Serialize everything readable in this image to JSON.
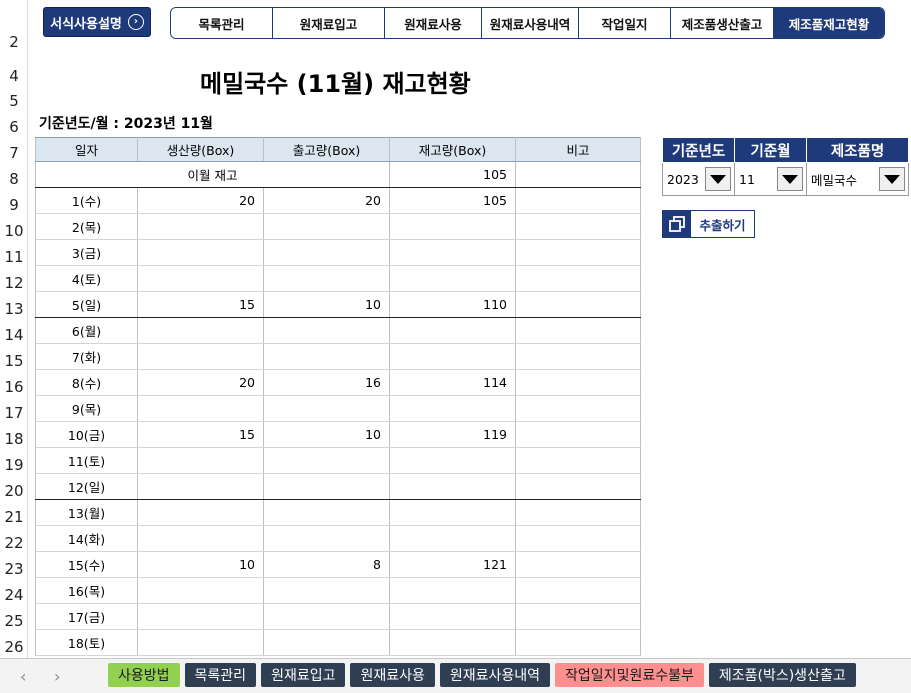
{
  "header": {
    "manual_button": "서식사용설명",
    "nav_tabs": [
      "목록관리",
      "원재료입고",
      "원재료사용",
      "원재료사용내역",
      "작업일지",
      "제조품생산출고",
      "제조품재고현황"
    ],
    "active_tab": "제조품재고현황"
  },
  "title": "메밀국수 (11월) 재고현황",
  "subtitle": "기준년도/월 : 2023년 11월",
  "table": {
    "columns": [
      "일자",
      "생산량(Box)",
      "출고량(Box)",
      "재고량(Box)",
      "비고"
    ],
    "carry_label": "이월 재고",
    "carry_value": "105",
    "rows": [
      {
        "date": "1(수)",
        "prod": "20",
        "out": "20",
        "stock": "105",
        "note": ""
      },
      {
        "date": "2(목)",
        "prod": "",
        "out": "",
        "stock": "",
        "note": ""
      },
      {
        "date": "3(금)",
        "prod": "",
        "out": "",
        "stock": "",
        "note": ""
      },
      {
        "date": "4(토)",
        "prod": "",
        "out": "",
        "stock": "",
        "note": ""
      },
      {
        "date": "5(일)",
        "prod": "15",
        "out": "10",
        "stock": "110",
        "note": ""
      },
      {
        "date": "6(월)",
        "prod": "",
        "out": "",
        "stock": "",
        "note": ""
      },
      {
        "date": "7(화)",
        "prod": "",
        "out": "",
        "stock": "",
        "note": ""
      },
      {
        "date": "8(수)",
        "prod": "20",
        "out": "16",
        "stock": "114",
        "note": ""
      },
      {
        "date": "9(목)",
        "prod": "",
        "out": "",
        "stock": "",
        "note": ""
      },
      {
        "date": "10(금)",
        "prod": "15",
        "out": "10",
        "stock": "119",
        "note": ""
      },
      {
        "date": "11(토)",
        "prod": "",
        "out": "",
        "stock": "",
        "note": ""
      },
      {
        "date": "12(일)",
        "prod": "",
        "out": "",
        "stock": "",
        "note": ""
      },
      {
        "date": "13(월)",
        "prod": "",
        "out": "",
        "stock": "",
        "note": ""
      },
      {
        "date": "14(화)",
        "prod": "",
        "out": "",
        "stock": "",
        "note": ""
      },
      {
        "date": "15(수)",
        "prod": "10",
        "out": "8",
        "stock": "121",
        "note": ""
      },
      {
        "date": "16(목)",
        "prod": "",
        "out": "",
        "stock": "",
        "note": ""
      },
      {
        "date": "17(금)",
        "prod": "",
        "out": "",
        "stock": "",
        "note": ""
      },
      {
        "date": "18(토)",
        "prod": "",
        "out": "",
        "stock": "",
        "note": ""
      }
    ]
  },
  "filter": {
    "headers": [
      "기준년도",
      "기준월",
      "제조품명"
    ],
    "year": "2023",
    "month": "11",
    "product": "메밀국수",
    "extract_button": "추출하기"
  },
  "row_numbers": [
    "2",
    "4",
    "5",
    "6",
    "7",
    "8",
    "9",
    "10",
    "11",
    "12",
    "13",
    "14",
    "15",
    "16",
    "17",
    "18",
    "19",
    "20",
    "21",
    "22",
    "23",
    "24",
    "25",
    "26"
  ],
  "sheet_tabs": [
    {
      "label": "사용방법",
      "style": "green"
    },
    {
      "label": "목록관리",
      "style": "dark"
    },
    {
      "label": "원재료입고",
      "style": "dark"
    },
    {
      "label": "원재료사용",
      "style": "dark"
    },
    {
      "label": "원재료사용내역",
      "style": "dark"
    },
    {
      "label": "작업일지및원료수불부",
      "style": "pink"
    },
    {
      "label": "제조품(박스)생산출고",
      "style": "dark"
    }
  ],
  "sheet_nav": {
    "prev": "‹",
    "next": "›"
  },
  "colors": {
    "navy": "#1f3a7a",
    "header_fill": "#dce6f1",
    "tab_dark": "#2f3e52",
    "tab_green": "#92d050",
    "tab_pink": "#ff8f8f"
  }
}
